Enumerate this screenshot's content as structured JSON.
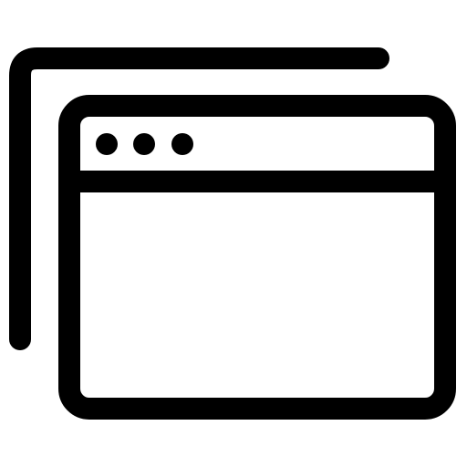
{
  "icon": {
    "name": "multiple-windows-icon",
    "stroke_color": "#000000",
    "background_color": "#ffffff",
    "window_control_dots": 3
  }
}
